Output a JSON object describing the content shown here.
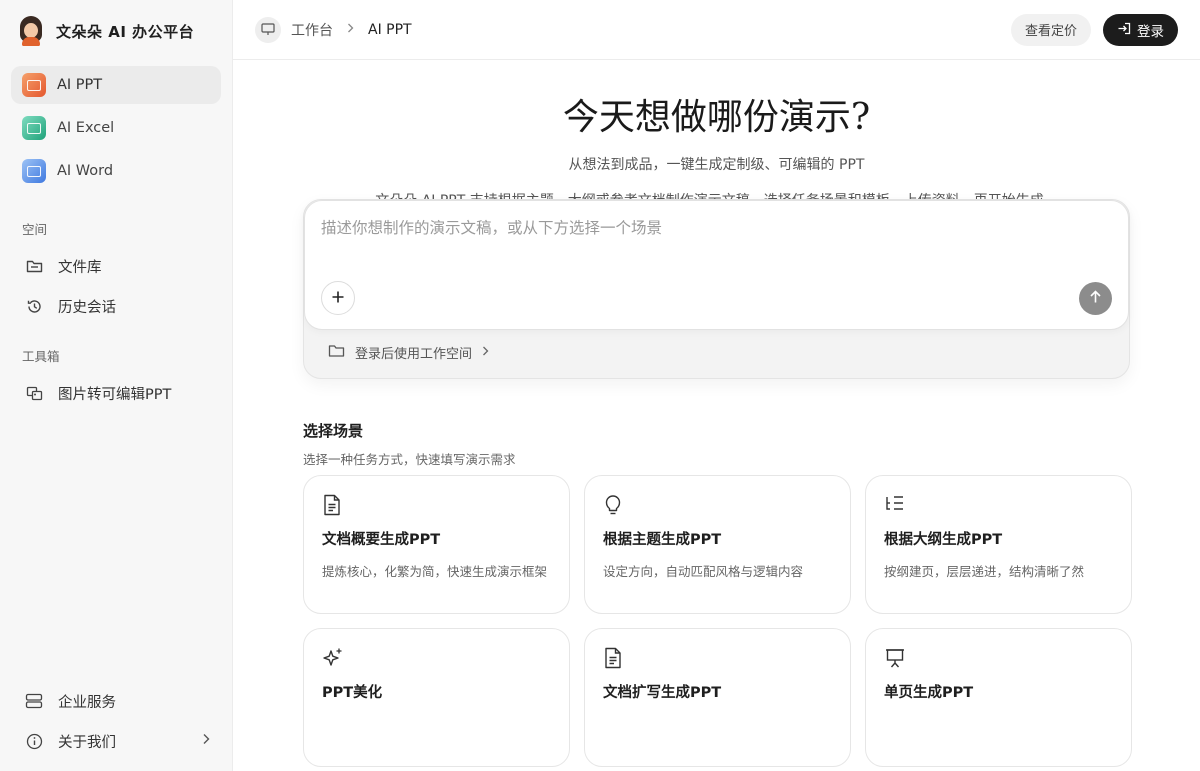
{
  "brand": {
    "title": "文朵朵 AI 办公平台"
  },
  "sidebar": {
    "apps": [
      {
        "label": "AI PPT",
        "active": true
      },
      {
        "label": "AI Excel",
        "active": false
      },
      {
        "label": "AI Word",
        "active": false
      }
    ],
    "space_label": "空间",
    "space_items": [
      {
        "label": "文件库",
        "icon": "folder-icon"
      },
      {
        "label": "历史会话",
        "icon": "history-icon"
      }
    ],
    "tools_label": "工具箱",
    "tool_items": [
      {
        "label": "图片转可编辑PPT",
        "icon": "image-convert-icon"
      }
    ],
    "bottom_items": [
      {
        "label": "企业服务",
        "icon": "server-icon"
      },
      {
        "label": "关于我们",
        "icon": "info-icon"
      }
    ]
  },
  "topbar": {
    "breadcrumb": [
      "工作台",
      "AI PPT"
    ],
    "pricing_label": "查看定价",
    "login_label": "登录"
  },
  "hero": {
    "title": "今天想做哪份演示?",
    "subtitle": "从想法到成品，一键生成定制级、可编辑的 PPT",
    "description": "文朵朵 AI PPT 支持根据主题、大纲或参考文档制作演示文稿。选择任务场景和模板，上传资料，再开始生成。"
  },
  "prompt": {
    "placeholder": "描述你想制作的演示文稿，或从下方选择一个场景",
    "value": "",
    "workspace_label": "登录后使用工作空间"
  },
  "scenes": {
    "title": "选择场景",
    "subtitle": "选择一种任务方式，快速填写演示需求",
    "cards": [
      {
        "title": "文档概要生成PPT",
        "desc": "提炼核心，化繁为简，快速生成演示框架",
        "icon": "document-icon"
      },
      {
        "title": "根据主题生成PPT",
        "desc": "设定方向，自动匹配风格与逻辑内容",
        "icon": "lightbulb-icon"
      },
      {
        "title": "根据大纲生成PPT",
        "desc": "按纲建页，层层递进，结构清晰了然",
        "icon": "outline-icon"
      },
      {
        "title": "PPT美化",
        "desc": "",
        "icon": "sparkle-icon"
      },
      {
        "title": "文档扩写生成PPT",
        "desc": "",
        "icon": "document-icon"
      },
      {
        "title": "单页生成PPT",
        "desc": "",
        "icon": "presentation-icon"
      }
    ]
  }
}
